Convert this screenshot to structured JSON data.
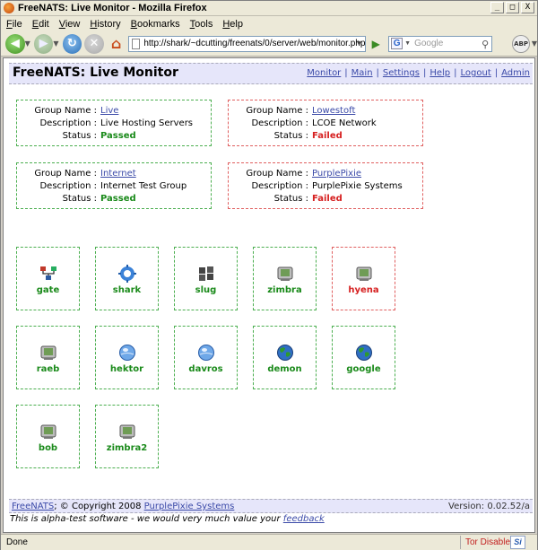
{
  "window": {
    "title": "FreeNATS: Live Monitor - Mozilla Firefox",
    "controls": [
      "_",
      "□",
      "X"
    ]
  },
  "menu": {
    "items": [
      {
        "key": "F",
        "rest": "ile"
      },
      {
        "key": "E",
        "rest": "dit"
      },
      {
        "key": "V",
        "rest": "iew"
      },
      {
        "key": "H",
        "rest": "istory"
      },
      {
        "key": "B",
        "rest": "ookmarks"
      },
      {
        "key": "T",
        "rest": "ools"
      },
      {
        "key": "H",
        "rest": "elp"
      }
    ]
  },
  "toolbar": {
    "url": "http://shark/~dcutting/freenats/0/server/web/monitor.php",
    "search_placeholder": "Google",
    "search_engine_letter": "G",
    "adblock_label": "ABP"
  },
  "page": {
    "title": "FreeNATS: Live Monitor",
    "nav_links": [
      "Monitor",
      "Main",
      "Settings",
      "Help",
      "Logout",
      "Admin"
    ],
    "labels": {
      "group_name": "Group Name :",
      "description": "Description :",
      "status": "Status :"
    },
    "groups": [
      {
        "name": "Live",
        "description": "Live Hosting Servers",
        "status": "Passed",
        "state": "pass"
      },
      {
        "name": "Lowestoft",
        "description": "LCOE Network",
        "status": "Failed",
        "state": "fail"
      },
      {
        "name": "Internet",
        "description": "Internet Test Group",
        "status": "Passed",
        "state": "pass"
      },
      {
        "name": "PurplePixie",
        "description": "PurplePixie Systems",
        "status": "Failed",
        "state": "fail"
      }
    ],
    "nodes": [
      {
        "name": "gate",
        "icon": "network-icon",
        "state": "pass"
      },
      {
        "name": "shark",
        "icon": "gear-icon",
        "state": "pass"
      },
      {
        "name": "slug",
        "icon": "windows-icon",
        "state": "pass"
      },
      {
        "name": "zimbra",
        "icon": "server-icon",
        "state": "pass"
      },
      {
        "name": "hyena",
        "icon": "server-icon",
        "state": "fail"
      },
      {
        "name": "raeb",
        "icon": "server-icon",
        "state": "pass"
      },
      {
        "name": "hektor",
        "icon": "globe-blue-icon",
        "state": "pass"
      },
      {
        "name": "davros",
        "icon": "globe-blue-icon",
        "state": "pass"
      },
      {
        "name": "demon",
        "icon": "globe-green-icon",
        "state": "pass"
      },
      {
        "name": "google",
        "icon": "globe-green-icon",
        "state": "pass"
      },
      {
        "name": "bob",
        "icon": "server-icon",
        "state": "pass"
      },
      {
        "name": "zimbra2",
        "icon": "server-icon",
        "state": "pass"
      }
    ],
    "footer": {
      "brand_link": "FreeNATS",
      "copyright": "; © Copyright 2008",
      "company_link": "PurplePixie Systems",
      "version": "Version: 0.02.52/a"
    },
    "alpha_note": "This is alpha-test software - we would very much value your",
    "feedback_link": "feedback"
  },
  "status_bar": {
    "text": "Done",
    "tor": "Tor Disabled",
    "si_badge": "Si"
  },
  "colors": {
    "pass": "#1a8a1a",
    "fail": "#d62020",
    "link": "#3b4aa8",
    "header_bg": "#e6e6fa"
  }
}
